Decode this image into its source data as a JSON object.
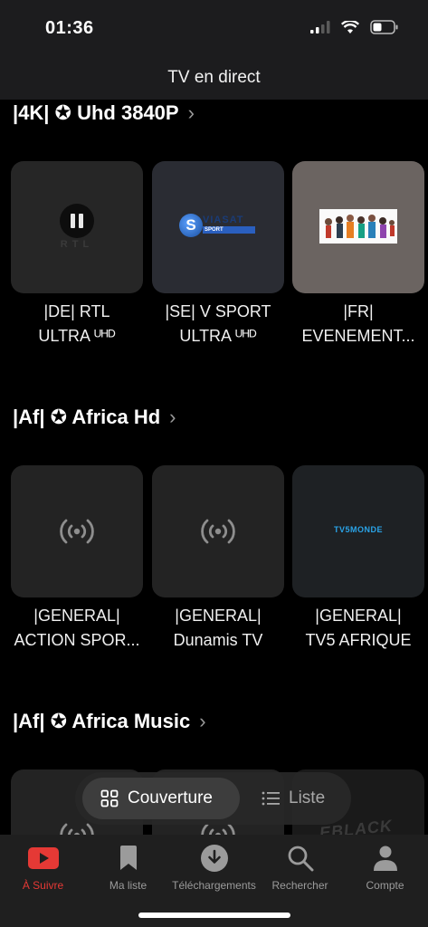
{
  "status_bar": {
    "time": "01:36"
  },
  "nav": {
    "title": "TV en direct"
  },
  "sections": [
    {
      "title": "|4K| ✪ Uhd 3840P",
      "cards": [
        {
          "line1": "|DE| RTL",
          "line2": "ULTRA ᵁᴴᴰ",
          "art": "RTL"
        },
        {
          "line1": "|SE| V SPORT",
          "line2": "ULTRA ᵁᴴᴰ",
          "art": "VIASAT",
          "art_sub": "SPORT"
        },
        {
          "line1": "|FR|",
          "line2": "EVENEMENT..."
        }
      ]
    },
    {
      "title": "|Af| ✪ Africa Hd",
      "cards": [
        {
          "line1": "|GENERAL|",
          "line2": "ACTION SPOR..."
        },
        {
          "line1": "|GENERAL|",
          "line2": "Dunamis TV"
        },
        {
          "line1": "|GENERAL|",
          "line2": "TV5 AFRIQUE",
          "art": "TV5MONDE"
        }
      ]
    },
    {
      "title": "|Af| ✪ Africa Music",
      "cards": [
        {
          "art": ""
        },
        {
          "art": ""
        },
        {
          "art": "EBLACK"
        }
      ]
    }
  ],
  "view_toggle": {
    "cover_label": "Couverture",
    "list_label": "Liste",
    "active": "cover"
  },
  "tab_bar": {
    "items": [
      {
        "label": "À Suivre",
        "icon": "play-icon",
        "active": true
      },
      {
        "label": "Ma liste",
        "icon": "bookmark-icon",
        "active": false
      },
      {
        "label": "Téléchargements",
        "icon": "download-icon",
        "active": false
      },
      {
        "label": "Rechercher",
        "icon": "search-icon",
        "active": false
      },
      {
        "label": "Compte",
        "icon": "person-icon",
        "active": false
      }
    ]
  },
  "colors": {
    "accent": "#e53935",
    "background": "#000000",
    "card": "#232323",
    "tv5": "#2aa4e8"
  }
}
